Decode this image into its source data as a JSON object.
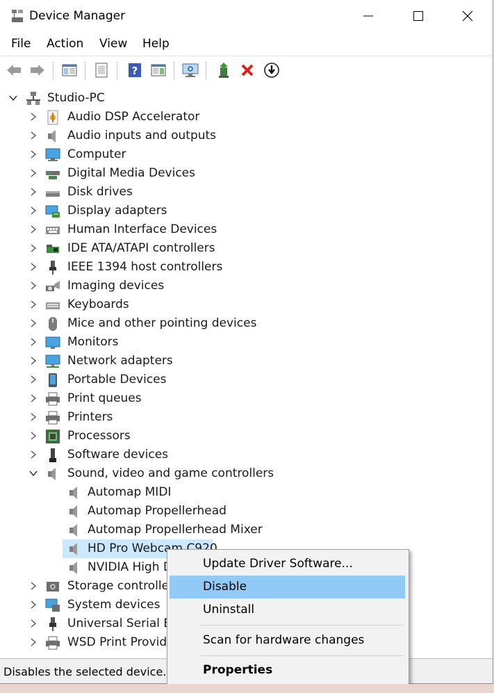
{
  "window": {
    "title": "Device Manager"
  },
  "menu": [
    "File",
    "Action",
    "View",
    "Help"
  ],
  "tree": {
    "root": "Studio-PC",
    "categories": [
      {
        "label": "Audio DSP Accelerator",
        "icon": "dsp-icon"
      },
      {
        "label": "Audio inputs and outputs",
        "icon": "speaker-icon"
      },
      {
        "label": "Computer",
        "icon": "computer-icon"
      },
      {
        "label": "Digital Media Devices",
        "icon": "media-device-icon"
      },
      {
        "label": "Disk drives",
        "icon": "disk-icon"
      },
      {
        "label": "Display adapters",
        "icon": "display-adapter-icon"
      },
      {
        "label": "Human Interface Devices",
        "icon": "hid-icon"
      },
      {
        "label": "IDE ATA/ATAPI controllers",
        "icon": "ide-icon"
      },
      {
        "label": "IEEE 1394 host controllers",
        "icon": "plug-icon"
      },
      {
        "label": "Imaging devices",
        "icon": "camera-icon"
      },
      {
        "label": "Keyboards",
        "icon": "keyboard-icon"
      },
      {
        "label": "Mice and other pointing devices",
        "icon": "mouse-icon"
      },
      {
        "label": "Monitors",
        "icon": "monitor-icon"
      },
      {
        "label": "Network adapters",
        "icon": "network-icon"
      },
      {
        "label": "Portable Devices",
        "icon": "phone-icon"
      },
      {
        "label": "Print queues",
        "icon": "printer-icon"
      },
      {
        "label": "Printers",
        "icon": "printer-icon"
      },
      {
        "label": "Processors",
        "icon": "processor-icon"
      },
      {
        "label": "Software devices",
        "icon": "software-device-icon"
      },
      {
        "label": "Sound, video and game controllers",
        "icon": "speaker-icon"
      }
    ],
    "sound_children": [
      "Automap MIDI",
      "Automap Propellerhead",
      "Automap Propellerhead Mixer",
      "HD Pro Webcam C920",
      "NVIDIA High Definition Audio"
    ],
    "after": [
      {
        "label": "Storage controllers",
        "icon": "storage-icon"
      },
      {
        "label": "System devices",
        "icon": "system-icon"
      },
      {
        "label": "Universal Serial Bus controllers",
        "icon": "usb-icon"
      },
      {
        "label": "WSD Print Provider",
        "icon": "printer-icon"
      }
    ]
  },
  "context_menu": {
    "update": "Update Driver Software...",
    "disable": "Disable",
    "uninstall": "Uninstall",
    "scan": "Scan for hardware changes",
    "properties": "Properties"
  },
  "status": "Disables the selected device.",
  "colors": {
    "selection": "#cce8ff",
    "menu_highlight": "#91c9f7"
  }
}
